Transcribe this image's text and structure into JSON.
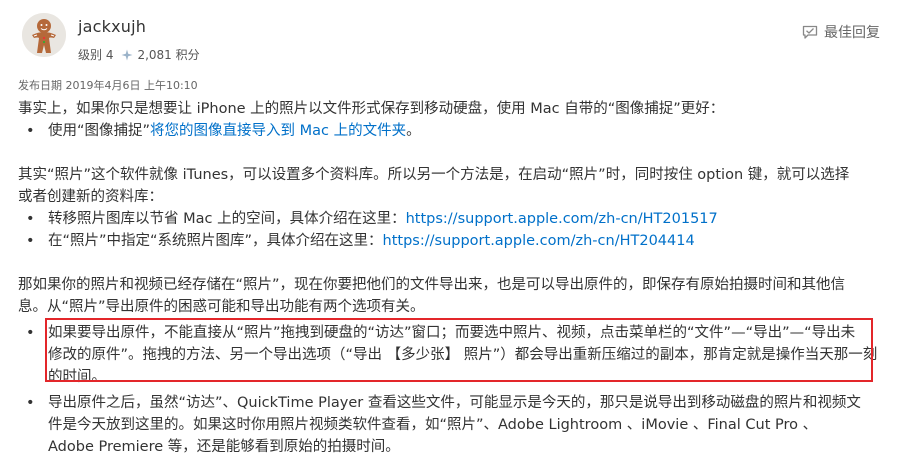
{
  "author": {
    "name": "jackxujh",
    "level": "级别 4",
    "points": "2,081 积分",
    "avatar_icon": "gingerbread-man-icon"
  },
  "actions": {
    "best_reply_label": "最佳回复",
    "best_reply_icon": "best-reply-icon"
  },
  "post": {
    "date": "发布日期 2019年4月6日 上午10:10",
    "para1": {
      "text": "事实上，如果你只是想要让 iPhone 上的照片以文件形式保存到移动硬盘，使用 Mac 自带的“图像捕捉”更好：",
      "items": [
        {
          "prefix": "使用“图像捕捉”",
          "link": "将您的图像直接导入到 Mac 上的文件夹",
          "suffix": "。"
        }
      ]
    },
    "para2": {
      "line1": "其实“照片”这个软件就像 iTunes，可以设置多个资料库。所以另一个方法是，在启动“照片”时，同时按住 option 键，就可以选择",
      "line2": "或者创建新的资料库：",
      "items": [
        {
          "prefix": "转移照片图库以节省 Mac 上的空间，具体介绍在这里：",
          "link": "https://support.apple.com/zh-cn/HT201517"
        },
        {
          "prefix": "在“照片”中指定“系统照片图库”，具体介绍在这里：",
          "link": "https://support.apple.com/zh-cn/HT204414"
        }
      ]
    },
    "para3": {
      "line1": "那如果你的照片和视频已经存储在“照片”，现在你要把他们的文件导出来，也是可以导出原件的，即保存有原始拍摄时间和其他信",
      "line2": "息。从“照片”导出原件的困惑可能和导出功能有两个选项有关。",
      "items": [
        {
          "line1": "如果要导出原件，不能直接从“照片”拖拽到硬盘的“访达”窗口；而要选中照片、视频，点击菜单栏的“文件”—“导出”—“导出未",
          "line2": "修改的原件”。拖拽的方法、另一个导出选项（“导出 【多少张】 照片”）都会导出重新压缩过的副本，那肯定就是操作当天那一刻",
          "line3": "的时间。"
        },
        {
          "line1": "导出原件之后，虽然“访达”、QuickTime Player 查看这些文件，可能显示是今天的，那只是说导出到移动磁盘的照片和视频文",
          "line2": "件是今天放到这里的。如果这时你用照片视频类软件查看，如“照片”、Adobe Lightroom 、iMovie 、Final Cut Pro 、",
          "line3": "Adobe Premiere 等，还是能够看到原始的拍摄时间。"
        }
      ]
    },
    "bullet": "•"
  },
  "colors": {
    "link": "#0070c9",
    "highlight_border": "#e3262a",
    "text": "#333333"
  }
}
